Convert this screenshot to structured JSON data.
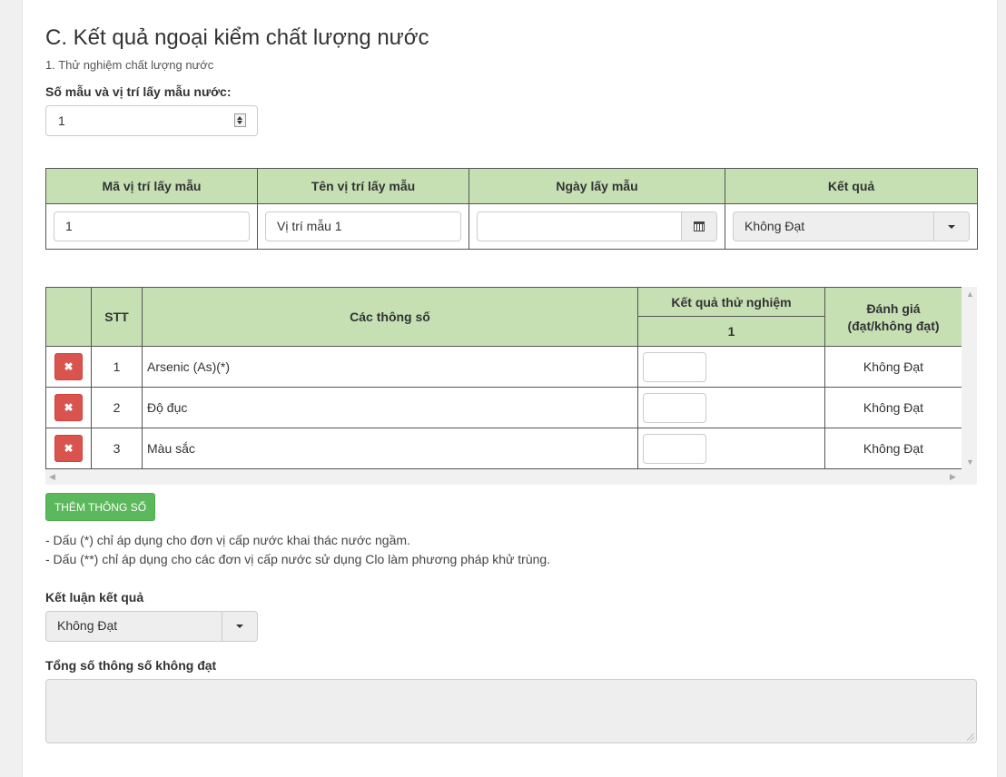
{
  "section": {
    "title": "C. Kết quả ngoại kiểm chất lượng nước",
    "subtitle": "1. Thử nghiệm chất lượng nước"
  },
  "sample_count": {
    "label": "Số mẫu và vị trí lấy mẫu nước:",
    "value": "1"
  },
  "sample_table": {
    "headers": [
      "Mã vị trí lấy mẫu",
      "Tên vị trí lấy mẫu",
      "Ngày lấy mẫu",
      "Kết quả"
    ],
    "row": {
      "code": "1",
      "name": "Vị trí mẫu 1",
      "date": "",
      "result": "Không Đạt"
    }
  },
  "param_table": {
    "headers": {
      "stt": "STT",
      "params": "Các thông số",
      "test_result": "Kết quả thử nghiệm",
      "test_result_sub": "1",
      "evaluation": "Đánh giá\n(đạt/không đạt)",
      "evaluation_line1": "Đánh giá",
      "evaluation_line2": "(đạt/không đạt)"
    },
    "rows": [
      {
        "stt": "1",
        "name": "Arsenic (As)(*)",
        "result": "",
        "evaluation": "Không Đạt"
      },
      {
        "stt": "2",
        "name": "Độ đục",
        "result": "",
        "evaluation": "Không Đạt"
      },
      {
        "stt": "3",
        "name": "Màu sắc",
        "result": "",
        "evaluation": "Không Đạt"
      }
    ]
  },
  "add_param_button": "THÊM THÔNG SỐ",
  "notes": [
    "- Dấu (*) chỉ áp dụng cho đơn vị cấp nước khai thác nước ngầm.",
    "- Dấu (**) chỉ áp dụng cho các đơn vị cấp nước sử dụng Clo làm phương pháp khử trùng."
  ],
  "conclusion": {
    "label": "Kết luận kết quả",
    "value": "Không Đạt"
  },
  "failed_total": {
    "label": "Tổng số thông số không đạt",
    "value": ""
  },
  "colors": {
    "header_bg": "#c6e0b4",
    "delete_button": "#d9534f",
    "add_button": "#5cb85c"
  }
}
